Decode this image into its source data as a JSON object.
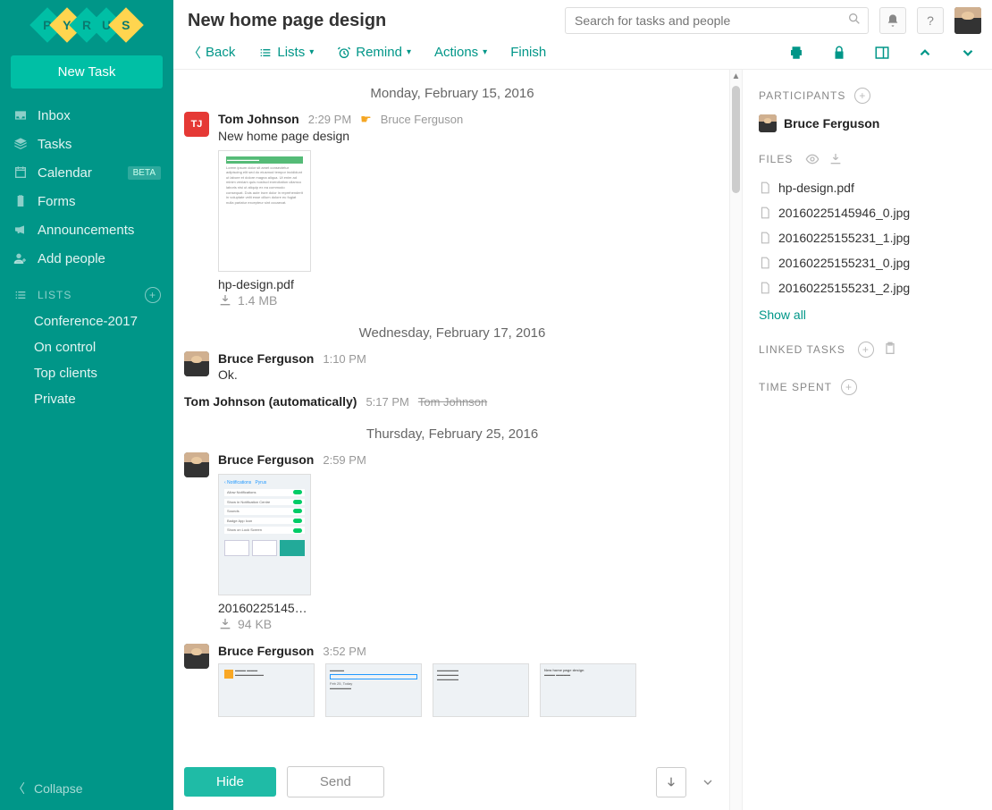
{
  "header": {
    "title": "New home page design",
    "search_placeholder": "Search for tasks and people"
  },
  "sidebar": {
    "new_task_label": "New Task",
    "nav": [
      {
        "label": "Inbox",
        "icon": "inbox"
      },
      {
        "label": "Tasks",
        "icon": "stack"
      },
      {
        "label": "Calendar",
        "icon": "calendar",
        "badge": "BETA"
      },
      {
        "label": "Forms",
        "icon": "clipboard"
      },
      {
        "label": "Announcements",
        "icon": "megaphone"
      },
      {
        "label": "Add people",
        "icon": "user-plus"
      }
    ],
    "lists_header": "LISTS",
    "lists": [
      {
        "label": "Conference-2017"
      },
      {
        "label": "On control"
      },
      {
        "label": "Top clients"
      },
      {
        "label": "Private"
      }
    ],
    "collapse_label": "Collapse"
  },
  "toolbar": {
    "back": "Back",
    "lists": "Lists",
    "remind": "Remind",
    "actions": "Actions",
    "finish": "Finish"
  },
  "thread": {
    "dates": {
      "d1": "Monday, February 15, 2016",
      "d2": "Wednesday, February 17, 2016",
      "d3": "Thursday, February 25, 2016"
    },
    "msg1": {
      "author": "Tom Johnson",
      "initials": "TJ",
      "time": "2:29 PM",
      "reactor": "Bruce Ferguson",
      "text": "New home page design",
      "att_name": "hp-design.pdf",
      "att_size": "1.4 MB"
    },
    "msg2": {
      "author": "Bruce Ferguson",
      "time": "1:10 PM",
      "text": "Ok."
    },
    "auto": {
      "author": "Tom Johnson (automatically)",
      "time": "5:17 PM",
      "reactor": "Tom Johnson"
    },
    "msg3": {
      "author": "Bruce Ferguson",
      "time": "2:59 PM",
      "att_name": "20160225145…",
      "att_size": "94 KB"
    },
    "msg4": {
      "author": "Bruce Ferguson",
      "time": "3:52 PM",
      "caption": "New home page design"
    }
  },
  "compose": {
    "hide": "Hide",
    "send": "Send"
  },
  "right": {
    "participants_header": "PARTICIPANTS",
    "participants": [
      {
        "name": "Bruce Ferguson"
      }
    ],
    "files_header": "FILES",
    "files": [
      {
        "name": "hp-design.pdf"
      },
      {
        "name": "20160225145946_0.jpg"
      },
      {
        "name": "20160225155231_1.jpg"
      },
      {
        "name": "20160225155231_0.jpg"
      },
      {
        "name": "20160225155231_2.jpg"
      }
    ],
    "show_all": "Show all",
    "linked_header": "LINKED TASKS",
    "time_spent_header": "TIME SPENT"
  }
}
